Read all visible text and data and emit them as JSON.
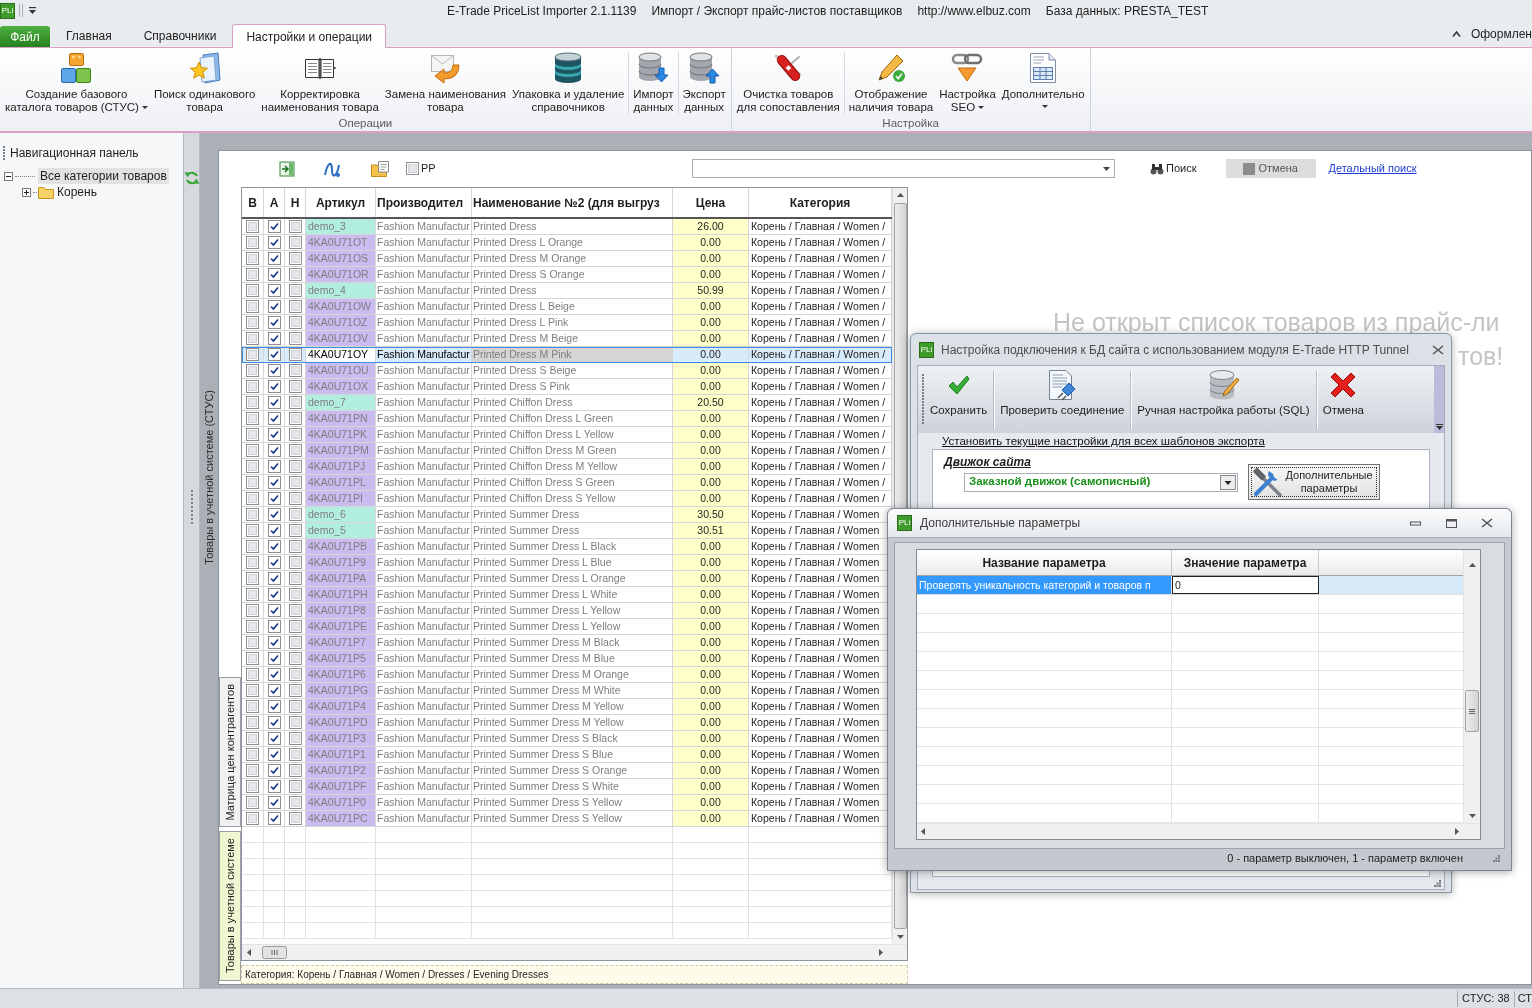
{
  "window": {
    "logo": "PLi",
    "title_parts": [
      "E-Trade PriceList Importer 2.1.1139",
      "Импорт / Экспорт прайс-листов поставщиков",
      "http://www.elbuz.com",
      "База данных: PRESTA_TEST"
    ]
  },
  "ribbon": {
    "tabs": [
      {
        "label": "Файл",
        "kind": "file",
        "selected": false
      },
      {
        "label": "Главная",
        "kind": "tab",
        "selected": false
      },
      {
        "label": "Справочники",
        "kind": "tab",
        "selected": false
      },
      {
        "label": "Настройки и операции",
        "kind": "tab",
        "selected": true
      }
    ],
    "style_menu": "Оформлен",
    "groups": [
      {
        "label": "Операции",
        "buttons": [
          {
            "lines": [
              "Создание базового",
              "каталога товаров (СТУС)"
            ],
            "dropdown": true
          },
          {
            "lines": [
              "Поиск одинакового",
              "товара"
            ],
            "dropdown": false
          },
          {
            "lines": [
              "Корректировка",
              "наименования товара"
            ],
            "dropdown": false
          },
          {
            "lines": [
              "Замена наименования",
              "товара"
            ],
            "dropdown": false
          },
          {
            "lines": [
              "Упаковка и удаление",
              "справочников"
            ],
            "dropdown": false
          },
          {
            "lines": [
              "Импорт",
              "данных"
            ],
            "dropdown": false
          },
          {
            "lines": [
              "Экспорт",
              "данных"
            ],
            "dropdown": false
          }
        ]
      },
      {
        "label": "Настройка",
        "buttons": [
          {
            "lines": [
              "Очистка товаров",
              "для сопоставления"
            ],
            "dropdown": false
          },
          {
            "lines": [
              "Отображение",
              "наличия товара"
            ],
            "dropdown": false
          },
          {
            "lines": [
              "Настройка",
              "SEO"
            ],
            "dropdown": true
          },
          {
            "lines": [
              "Дополнительно"
            ],
            "dropdown": true
          }
        ]
      }
    ]
  },
  "nav_panel": {
    "title": "Навигационная панель",
    "tree": [
      {
        "label": "Все категории товаров",
        "selected": true,
        "expanded": true,
        "children": [
          {
            "label": "Корень",
            "selected": false,
            "expanded": false
          }
        ]
      }
    ]
  },
  "side_tab": "Товары в учетной системе (СТУС)",
  "toolbar": {
    "pp": {
      "label": "PP",
      "checked": false
    },
    "search_button": "Поиск",
    "cancel_button": "Отмена",
    "advanced_search_link": "Детальный поиск"
  },
  "table": {
    "columns": [
      "В",
      "А",
      "Н",
      "Артикул",
      "Производител",
      "Наименование №2 (для выгруз",
      "Цена",
      "Категория"
    ],
    "rows": [
      {
        "kind": "base",
        "checked": [
          false,
          true,
          false
        ],
        "article": "demo_3",
        "manufacturer": "Fashion Manufactur",
        "name": "Printed Dress",
        "price": "26.00",
        "category": "Корень / Главная / Women /",
        "selected": false
      },
      {
        "kind": "variant",
        "checked": [
          false,
          true,
          false
        ],
        "article": "4KA0U71OT",
        "manufacturer": "Fashion Manufactur",
        "name": "Printed Dress L Orange",
        "price": "0.00",
        "category": "Корень / Главная / Women /",
        "selected": false
      },
      {
        "kind": "variant",
        "checked": [
          false,
          true,
          false
        ],
        "article": "4KA0U71OS",
        "manufacturer": "Fashion Manufactur",
        "name": "Printed Dress M Orange",
        "price": "0.00",
        "category": "Корень / Главная / Women /",
        "selected": false
      },
      {
        "kind": "variant",
        "checked": [
          false,
          true,
          false
        ],
        "article": "4KA0U71OR",
        "manufacturer": "Fashion Manufactur",
        "name": "Printed Dress S Orange",
        "price": "0.00",
        "category": "Корень / Главная / Women /",
        "selected": false
      },
      {
        "kind": "base",
        "checked": [
          false,
          true,
          false
        ],
        "article": "demo_4",
        "manufacturer": "Fashion Manufactur",
        "name": "Printed Dress",
        "price": "50.99",
        "category": "Корень / Главная / Women /",
        "selected": false
      },
      {
        "kind": "variant",
        "checked": [
          false,
          true,
          false
        ],
        "article": "4KA0U71OW",
        "manufacturer": "Fashion Manufactur",
        "name": "Printed Dress L Beige",
        "price": "0.00",
        "category": "Корень / Главная / Women /",
        "selected": false
      },
      {
        "kind": "variant",
        "checked": [
          false,
          true,
          false
        ],
        "article": "4KA0U71OZ",
        "manufacturer": "Fashion Manufactur",
        "name": "Printed Dress L Pink",
        "price": "0.00",
        "category": "Корень / Главная / Women /",
        "selected": false
      },
      {
        "kind": "variant",
        "checked": [
          false,
          true,
          false
        ],
        "article": "4KA0U71OV",
        "manufacturer": "Fashion Manufactur",
        "name": "Printed Dress M Beige",
        "price": "0.00",
        "category": "Корень / Главная / Women /",
        "selected": false
      },
      {
        "checked": [
          false,
          true,
          false
        ],
        "article": "4KA0U71OY",
        "manufacturer": "Fashion Manufactur",
        "name": "Printed Dress M Pink",
        "price": "0.00",
        "category": "Корень / Главная / Women /",
        "selected": true
      },
      {
        "kind": "variant",
        "checked": [
          false,
          true,
          false
        ],
        "article": "4KA0U71OU",
        "manufacturer": "Fashion Manufactur",
        "name": "Printed Dress S Beige",
        "price": "0.00",
        "category": "Корень / Главная / Women /",
        "selected": false
      },
      {
        "kind": "variant",
        "checked": [
          false,
          true,
          false
        ],
        "article": "4KA0U71OX",
        "manufacturer": "Fashion Manufactur",
        "name": "Printed Dress S Pink",
        "price": "0.00",
        "category": "Корень / Главная / Women /",
        "selected": false
      },
      {
        "kind": "base",
        "checked": [
          false,
          true,
          false
        ],
        "article": "demo_7",
        "manufacturer": "Fashion Manufactur",
        "name": "Printed Chiffon Dress",
        "price": "20.50",
        "category": "Корень / Главная / Women /",
        "selected": false
      },
      {
        "kind": "variant",
        "checked": [
          false,
          true,
          false
        ],
        "article": "4KA0U71PN",
        "manufacturer": "Fashion Manufactur",
        "name": "Printed Chiffon Dress L Green",
        "price": "0.00",
        "category": "Корень / Главная / Women /",
        "selected": false
      },
      {
        "kind": "variant",
        "checked": [
          false,
          true,
          false
        ],
        "article": "4KA0U71PK",
        "manufacturer": "Fashion Manufactur",
        "name": "Printed Chiffon Dress L Yellow",
        "price": "0.00",
        "category": "Корень / Главная / Women /",
        "selected": false
      },
      {
        "kind": "variant",
        "checked": [
          false,
          true,
          false
        ],
        "article": "4KA0U71PM",
        "manufacturer": "Fashion Manufactur",
        "name": "Printed Chiffon Dress M Green",
        "price": "0.00",
        "category": "Корень / Главная / Women /",
        "selected": false
      },
      {
        "kind": "variant",
        "checked": [
          false,
          true,
          false
        ],
        "article": "4KA0U71PJ",
        "manufacturer": "Fashion Manufactur",
        "name": "Printed Chiffon Dress M Yellow",
        "price": "0.00",
        "category": "Корень / Главная / Women /",
        "selected": false
      },
      {
        "kind": "variant",
        "checked": [
          false,
          true,
          false
        ],
        "article": "4KA0U71PL",
        "manufacturer": "Fashion Manufactur",
        "name": "Printed Chiffon Dress S Green",
        "price": "0.00",
        "category": "Корень / Главная / Women /",
        "selected": false
      },
      {
        "kind": "variant",
        "checked": [
          false,
          true,
          false
        ],
        "article": "4KA0U71PI",
        "manufacturer": "Fashion Manufactur",
        "name": "Printed Chiffon Dress S Yellow",
        "price": "0.00",
        "category": "Корень / Главная / Women /",
        "selected": false
      },
      {
        "kind": "base",
        "checked": [
          false,
          true,
          false
        ],
        "article": "demo_6",
        "manufacturer": "Fashion Manufactur",
        "name": "Printed Summer Dress",
        "price": "30.50",
        "category": "Корень / Главная / Women",
        "selected": false
      },
      {
        "kind": "base",
        "checked": [
          false,
          true,
          false
        ],
        "article": "demo_5",
        "manufacturer": "Fashion Manufactur",
        "name": "Printed Summer Dress",
        "price": "30.51",
        "category": "Корень / Главная / Women",
        "selected": false
      },
      {
        "kind": "variant",
        "checked": [
          false,
          true,
          false
        ],
        "article": "4KA0U71PB",
        "manufacturer": "Fashion Manufactur",
        "name": "Printed Summer Dress L Black",
        "price": "0.00",
        "category": "Корень / Главная / Women",
        "selected": false
      },
      {
        "kind": "variant",
        "checked": [
          false,
          true,
          false
        ],
        "article": "4KA0U71P9",
        "manufacturer": "Fashion Manufactur",
        "name": "Printed Summer Dress L Blue",
        "price": "0.00",
        "category": "Корень / Главная / Women",
        "selected": false
      },
      {
        "kind": "variant",
        "checked": [
          false,
          true,
          false
        ],
        "article": "4KA0U71PA",
        "manufacturer": "Fashion Manufactur",
        "name": "Printed Summer Dress L Orange",
        "price": "0.00",
        "category": "Корень / Главная / Women",
        "selected": false
      },
      {
        "kind": "variant",
        "checked": [
          false,
          true,
          false
        ],
        "article": "4KA0U71PH",
        "manufacturer": "Fashion Manufactur",
        "name": "Printed Summer Dress L White",
        "price": "0.00",
        "category": "Корень / Главная / Women",
        "selected": false
      },
      {
        "kind": "variant",
        "checked": [
          false,
          true,
          false
        ],
        "article": "4KA0U71P8",
        "manufacturer": "Fashion Manufactur",
        "name": "Printed Summer Dress L Yellow",
        "price": "0.00",
        "category": "Корень / Главная / Women",
        "selected": false
      },
      {
        "kind": "variant",
        "checked": [
          false,
          true,
          false
        ],
        "article": "4KA0U71PE",
        "manufacturer": "Fashion Manufactur",
        "name": "Printed Summer Dress L Yellow",
        "price": "0.00",
        "category": "Корень / Главная / Women",
        "selected": false
      },
      {
        "kind": "variant",
        "checked": [
          false,
          true,
          false
        ],
        "article": "4KA0U71P7",
        "manufacturer": "Fashion Manufactur",
        "name": "Printed Summer Dress M Black",
        "price": "0.00",
        "category": "Корень / Главная / Women",
        "selected": false
      },
      {
        "kind": "variant",
        "checked": [
          false,
          true,
          false
        ],
        "article": "4KA0U71P5",
        "manufacturer": "Fashion Manufactur",
        "name": "Printed Summer Dress M Blue",
        "price": "0.00",
        "category": "Корень / Главная / Women",
        "selected": false
      },
      {
        "kind": "variant",
        "checked": [
          false,
          true,
          false
        ],
        "article": "4KA0U71P6",
        "manufacturer": "Fashion Manufactur",
        "name": "Printed Summer Dress M Orange",
        "price": "0.00",
        "category": "Корень / Главная / Women",
        "selected": false
      },
      {
        "kind": "variant",
        "checked": [
          false,
          true,
          false
        ],
        "article": "4KA0U71PG",
        "manufacturer": "Fashion Manufactur",
        "name": "Printed Summer Dress M White",
        "price": "0.00",
        "category": "Корень / Главная / Women",
        "selected": false
      },
      {
        "kind": "variant",
        "checked": [
          false,
          true,
          false
        ],
        "article": "4KA0U71P4",
        "manufacturer": "Fashion Manufactur",
        "name": "Printed Summer Dress M Yellow",
        "price": "0.00",
        "category": "Корень / Главная / Women",
        "selected": false
      },
      {
        "kind": "variant",
        "checked": [
          false,
          true,
          false
        ],
        "article": "4KA0U71PD",
        "manufacturer": "Fashion Manufactur",
        "name": "Printed Summer Dress M Yellow",
        "price": "0.00",
        "category": "Корень / Главная / Women",
        "selected": false
      },
      {
        "kind": "variant",
        "checked": [
          false,
          true,
          false
        ],
        "article": "4KA0U71P3",
        "manufacturer": "Fashion Manufactur",
        "name": "Printed Summer Dress S Black",
        "price": "0.00",
        "category": "Корень / Главная / Women",
        "selected": false
      },
      {
        "kind": "variant",
        "checked": [
          false,
          true,
          false
        ],
        "article": "4KA0U71P1",
        "manufacturer": "Fashion Manufactur",
        "name": "Printed Summer Dress S Blue",
        "price": "0.00",
        "category": "Корень / Главная / Women",
        "selected": false
      },
      {
        "kind": "variant",
        "checked": [
          false,
          true,
          false
        ],
        "article": "4KA0U71P2",
        "manufacturer": "Fashion Manufactur",
        "name": "Printed Summer Dress S Orange",
        "price": "0.00",
        "category": "Корень / Главная / Women",
        "selected": false
      },
      {
        "kind": "variant",
        "checked": [
          false,
          true,
          false
        ],
        "article": "4KA0U71PF",
        "manufacturer": "Fashion Manufactur",
        "name": "Printed Summer Dress S White",
        "price": "0.00",
        "category": "Корень / Главная / Women",
        "selected": false
      },
      {
        "kind": "variant",
        "checked": [
          false,
          true,
          false
        ],
        "article": "4KA0U71P0",
        "manufacturer": "Fashion Manufactur",
        "name": "Printed Summer Dress S Yellow",
        "price": "0.00",
        "category": "Корень / Главная / Women",
        "selected": false
      },
      {
        "kind": "variant",
        "checked": [
          false,
          true,
          false
        ],
        "article": "4KA0U71PC",
        "manufacturer": "Fashion Manufactur",
        "name": "Printed Summer Dress S Yellow",
        "price": "0.00",
        "category": "Корень / Главная / Women",
        "selected": false
      }
    ]
  },
  "category_path": "Категория: Корень / Главная / Women / Dresses / Evening Dresses",
  "view_tabs": [
    {
      "label": "Матрица цен контрагентов",
      "selected": false
    },
    {
      "label": "Товары в учетной системе",
      "selected": true
    }
  ],
  "empty_message": [
    "Не открыт список товаров из прайс-ли",
    "тов!"
  ],
  "connection_dialog": {
    "logo": "PLi",
    "title": "Настройка подключения к БД сайта с использованием модуля E-Trade HTTP Tunnel",
    "toolbar": [
      "Сохранить",
      "Проверить соединение",
      "Ручная настройка работы (SQL)",
      "Отмена"
    ],
    "apply_all_link": "Установить текущие настройки для всех шаблонов экспорта",
    "engine_group": {
      "title": "Движок сайта",
      "value": "Заказной движок (самописный)",
      "params_button": "Дополнительные параметры"
    }
  },
  "params_dialog": {
    "logo": "PLi",
    "title": "Дополнительные параметры",
    "columns": [
      "Название параметра",
      "Значение параметра"
    ],
    "rows": [
      {
        "name": "Проверять уникальность категорий и товаров п",
        "value": "0",
        "selected": true
      }
    ],
    "hint": "0 - параметр выключен, 1 - параметр включен"
  },
  "status_bar": [
    "СТУС: 38",
    "СТ"
  ]
}
